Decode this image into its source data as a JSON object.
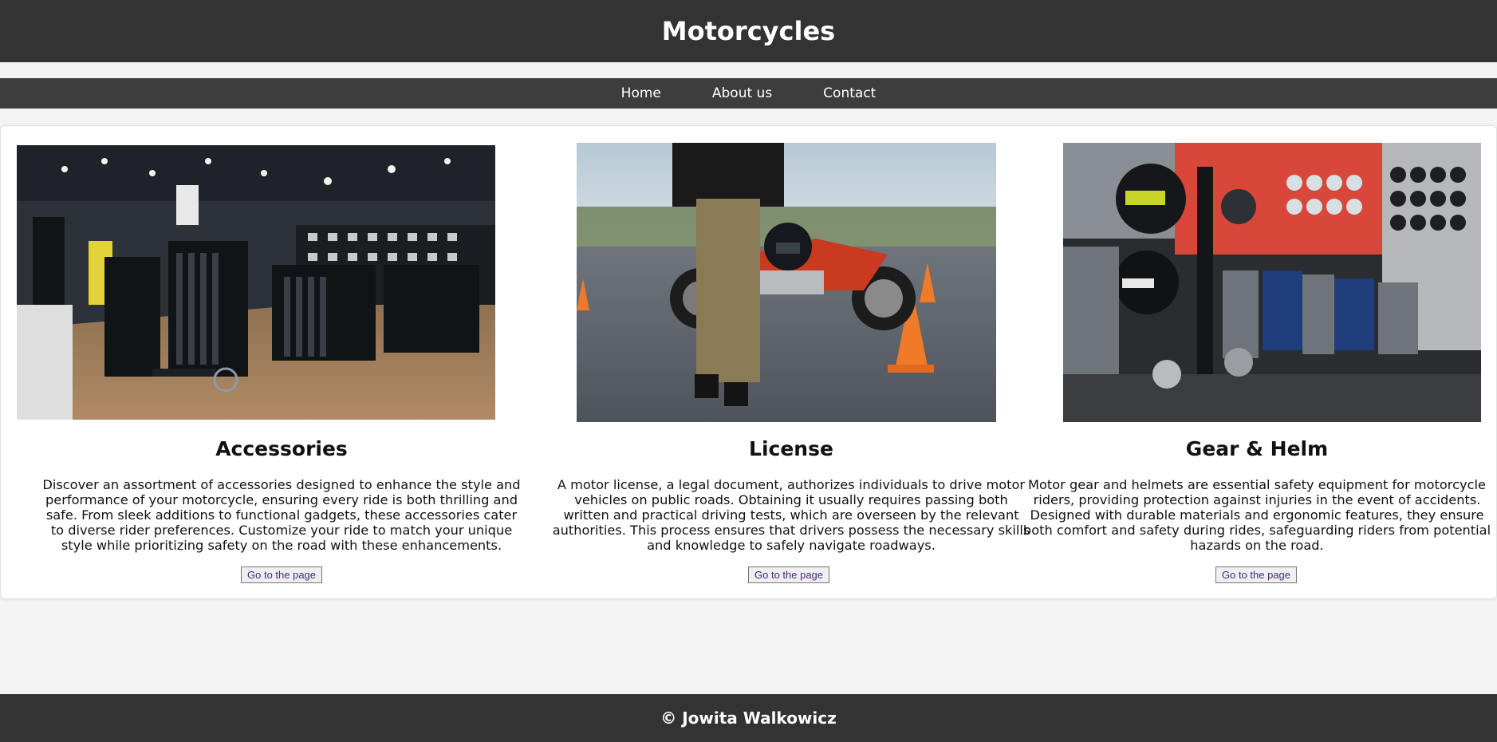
{
  "header": {
    "title": "Motorcycles"
  },
  "nav": {
    "items": [
      {
        "label": "Home"
      },
      {
        "label": "About us"
      },
      {
        "label": "Contact"
      }
    ]
  },
  "cards": [
    {
      "title": "Accessories",
      "text": "Discover an assortment of accessories designed to enhance the style and performance of your motorcycle, ensuring every ride is both thrilling and safe. From sleek additions to functional gadgets, these accessories cater to diverse rider preferences. Customize your ride to match your unique style while prioritizing safety on the road with these enhancements.",
      "button_label": "Go to the page"
    },
    {
      "title": "License",
      "text": "A motor license, a legal document, authorizes individuals to drive motor vehicles on public roads. Obtaining it usually requires passing both written and practical driving tests, which are overseen by the relevant authorities. This process ensures that drivers possess the necessary skills and knowledge to safely navigate roadways.",
      "button_label": "Go to the page"
    },
    {
      "title": "Gear & Helm",
      "text": "Motor gear and helmets are essential safety equipment for motorcycle riders, providing protection against injuries in the event of accidents. Designed with durable materials and ergonomic features, they ensure both comfort and safety during rides, safeguarding riders from potential hazards on the road.",
      "button_label": "Go to the page"
    }
  ],
  "footer": {
    "text": "© Jowita Walkowicz"
  },
  "colors": {
    "header_bg": "#333333",
    "nav_bg": "#3d3d3d",
    "page_bg": "#f4f4f4",
    "button_text": "#4a2a7a"
  }
}
